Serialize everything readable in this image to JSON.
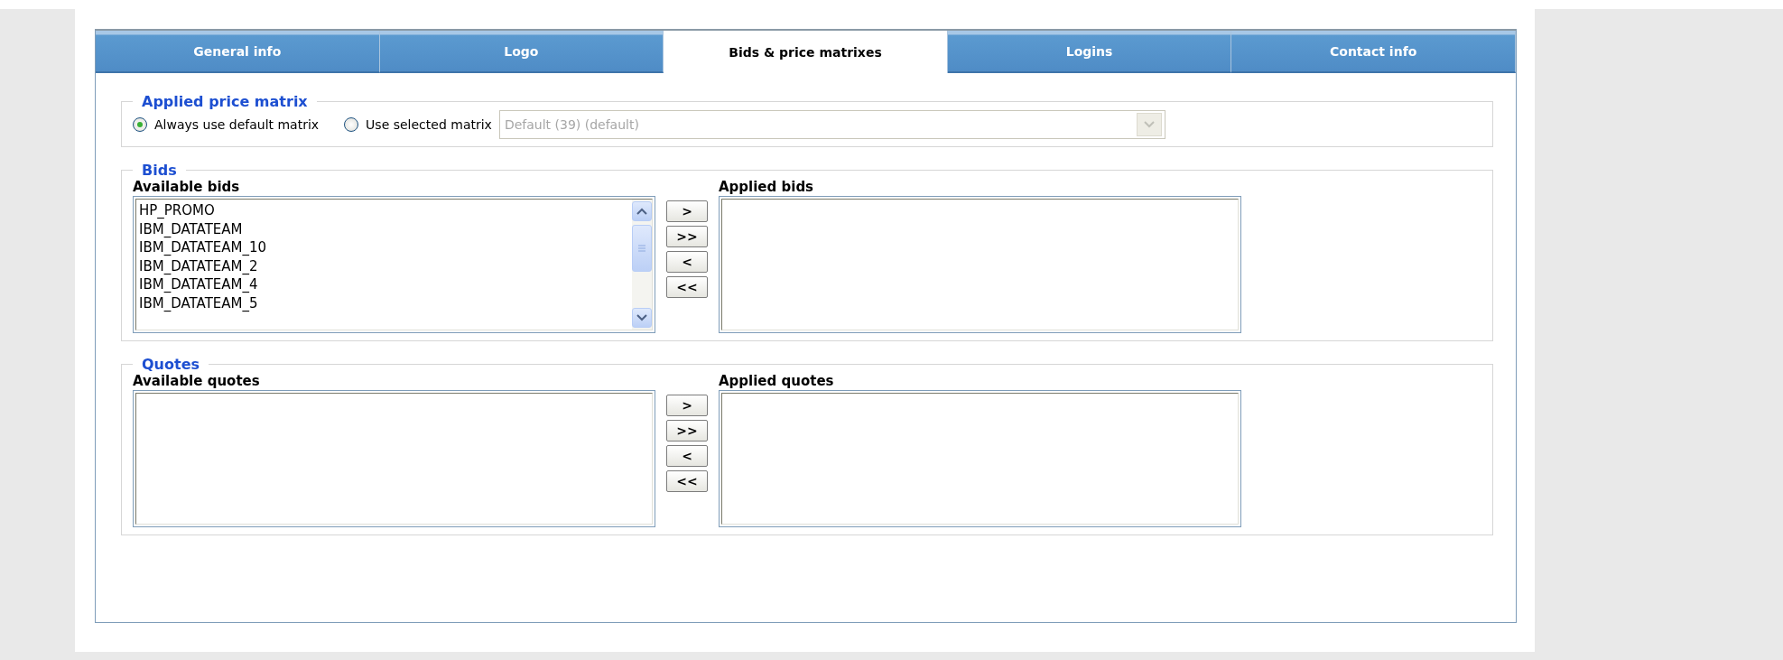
{
  "tabs": [
    {
      "label": "General info",
      "selected": false
    },
    {
      "label": "Logo",
      "selected": false
    },
    {
      "label": "Bids & price matrixes",
      "selected": true
    },
    {
      "label": "Logins",
      "selected": false
    },
    {
      "label": "Contact info",
      "selected": false
    }
  ],
  "price_matrix": {
    "legend": "Applied price matrix",
    "options": [
      {
        "label": "Always use default matrix",
        "selected": true
      },
      {
        "label": "Use selected matrix",
        "selected": false
      }
    ],
    "select": {
      "value": "Default (39) (default)",
      "disabled": true
    }
  },
  "bids": {
    "legend": "Bids",
    "available": {
      "label": "Available bids",
      "items": [
        "HP_PROMO",
        "IBM_DATATEAM",
        "IBM_DATATEAM_10",
        "IBM_DATATEAM_2",
        "IBM_DATATEAM_4",
        "IBM_DATATEAM_5"
      ]
    },
    "buttons": [
      ">",
      ">>",
      "<",
      "<<"
    ],
    "applied": {
      "label": "Applied bids"
    }
  },
  "quotes": {
    "legend": "Quotes",
    "available": {
      "label": "Available quotes"
    },
    "buttons": [
      ">",
      ">>",
      "<",
      "<<"
    ],
    "applied": {
      "label": "Applied quotes"
    }
  }
}
